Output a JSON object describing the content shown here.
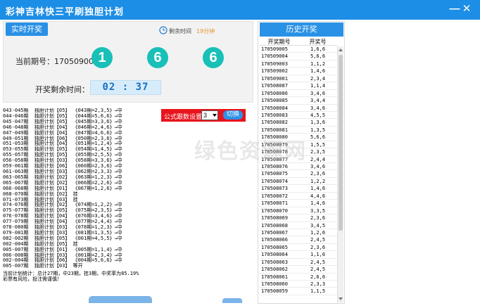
{
  "window": {
    "title": "彩神吉林快三平刷独胆计划",
    "minimize": "—",
    "close": "✕"
  },
  "top": {
    "realtime_button": "实时开奖",
    "remaining_label": "剩余时间",
    "remaining_value": "19分钟",
    "issue_label": "当前期号：170509005",
    "balls": [
      "1",
      "6",
      "6"
    ],
    "countdown_label": "开奖剩余时间：",
    "countdown_value": "02 : 37"
  },
  "formula": {
    "label": "公式跟数设置",
    "selected": "3",
    "switch_button": "切换"
  },
  "log_lines": [
    "043-045期  独胆计划【05】 《043期=2,3,5》→中",
    "044-046期  独胆计划【05】 《044期=5,6,6》→中",
    "045-047期  独胆计划【05】 《045期=3,3,6》→中",
    "046-048期  独胆计划【04】 《046期=2,4,6》→中",
    "047-049期  独胆计划【04】 《047期=4,6,6》→中",
    "049-051期  独胆计划【06】 《050期=2,3,6》→中",
    "051-053期  独胆计划【04】 《051期=1,2,4》→中",
    "053-055期  独胆计划【05】 《054期=1,4,5》→中",
    "055-057期  独胆计划【05】 《055期=2,5,5》→中",
    "056-058期  独胆计划【03】 《058期=3,3,6》→中",
    "059-061期  独胆计划【06】 《060期=2,3,6》→中",
    "061-063期  独胆计划【03】 《062期=2,3,3》→中",
    "063-065期  独胆计划【02】 《063期=1,2,3》→中",
    "065-067期  独胆计划【02】 《066期=2,2,6》→中",
    "066-068期  独胆计划【01】 《067期=1,2,6》→中",
    "068-070期  独胆计划【02】 挂",
    "071-073期  独胆计划【03】 挂",
    "074-076期  独胆计划【02】 《074期=1,2,2》→中",
    "075-077期  独胆计划【05】 《075期=2,3,5》→中",
    "076-078期  独胆计划【04】 《076期=3,4,6》→中",
    "077-079期  独胆计划【04】 《077期=2,4,4》→中",
    "078-080期  独胆计划【03】 《078期=1,2,3》→中",
    "079-081期  独胆计划【03】 《081期=1,3,5》→中",
    "082-002期  独胆计划【05】 《001期=4,5,5》→中",
    "002-004期  独胆计划【05】 挂",
    "005-007期  独胆计划【01】 《005期=1,1,4》→中",
    "006-008期  独胆计划【03】 《001期=2,3,4》→中",
    "002-004期  独胆计划【06】 《004期=5,6,6》→中",
    "005-007期  独胆计划【03】 等开"
  ],
  "summary": [
    "当前计划统计：总计27期，中23期，挂3期，中奖率为85.19%",
    "彩票有风险，投注需谨慎！"
  ],
  "history": {
    "header": "历史开奖",
    "col_issue": "开奖期号",
    "col_number": "开奖号",
    "rows": [
      [
        "170509005",
        "1,6,6"
      ],
      [
        "170509004",
        "5,6,6"
      ],
      [
        "170509003",
        "1,1,2"
      ],
      [
        "170509002",
        "1,4,6"
      ],
      [
        "170509001",
        "2,3,4"
      ],
      [
        "170508087",
        "1,1,4"
      ],
      [
        "170508086",
        "3,4,6"
      ],
      [
        "170508085",
        "3,4,4"
      ],
      [
        "170508084",
        "3,4,6"
      ],
      [
        "170508083",
        "4,5,5"
      ],
      [
        "170508082",
        "1,3,6"
      ],
      [
        "170508081",
        "1,3,5"
      ],
      [
        "170508080",
        "5,6,6"
      ],
      [
        "170508079",
        "1,5,5"
      ],
      [
        "170508078",
        "2,3,5"
      ],
      [
        "170508077",
        "2,4,4"
      ],
      [
        "170508076",
        "3,4,6"
      ],
      [
        "170508075",
        "2,3,6"
      ],
      [
        "170508074",
        "1,2,2"
      ],
      [
        "170508073",
        "1,4,6"
      ],
      [
        "170508072",
        "4,4,6"
      ],
      [
        "170508071",
        "1,4,6"
      ],
      [
        "170508070",
        "3,3,5"
      ],
      [
        "170508069",
        "2,3,6"
      ],
      [
        "170508068",
        "3,4,5"
      ],
      [
        "170508067",
        "1,2,6"
      ],
      [
        "170508066",
        "2,4,5"
      ],
      [
        "170508065",
        "2,3,6"
      ],
      [
        "170508064",
        "1,1,6"
      ],
      [
        "170508063",
        "2,4,5"
      ],
      [
        "170508062",
        "2,4,5"
      ],
      [
        "170508061",
        "2,6,6"
      ],
      [
        "170508060",
        "2,3,3"
      ],
      [
        "170508059",
        "1,1,5"
      ]
    ]
  }
}
